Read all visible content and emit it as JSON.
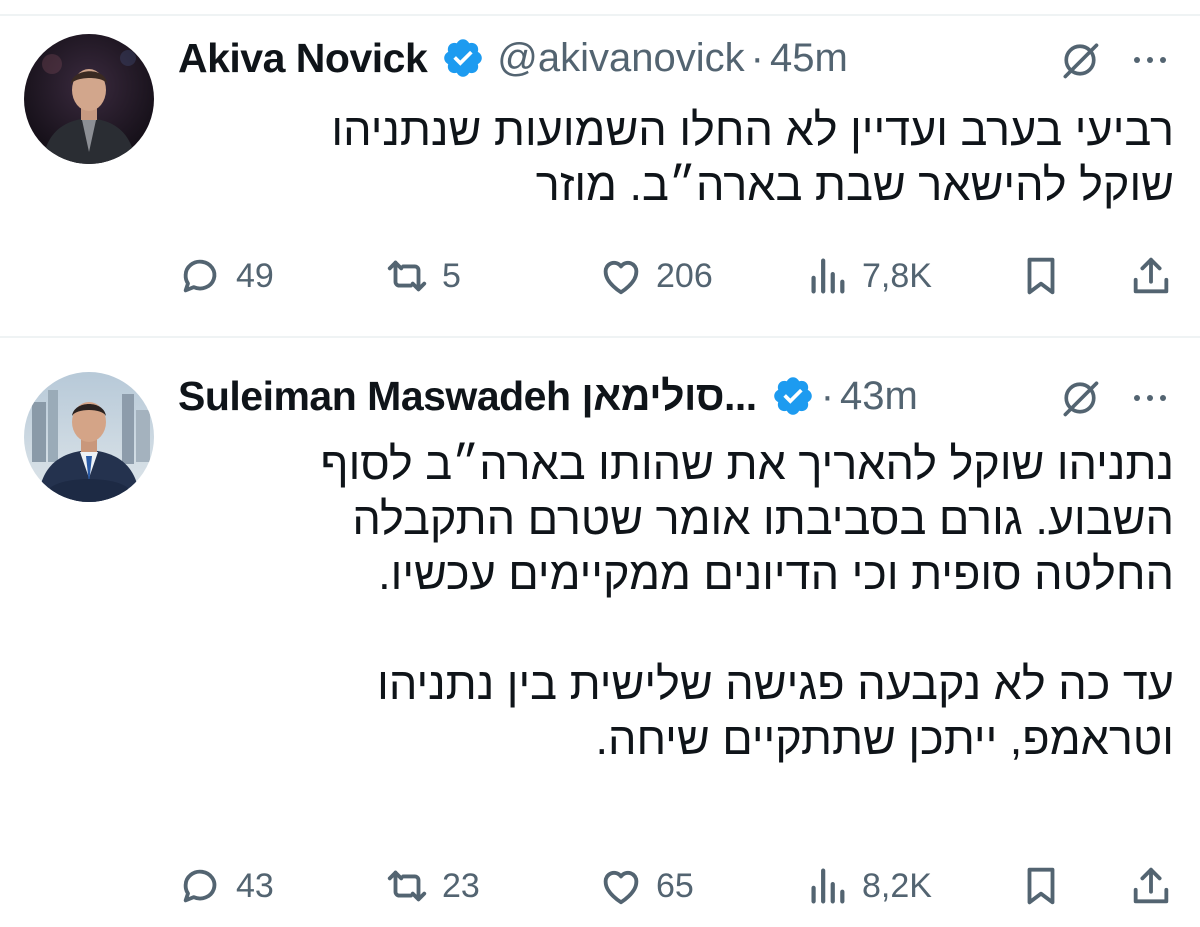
{
  "tweets": [
    {
      "name": "Akiva Novick",
      "handle": "@akivanovick",
      "separator": "·",
      "time": "45m",
      "text": "רביעי בערב ועדיין לא החלו השמועות שנתניהו\nשוקל להישאר שבת בארה״ב. מוזר",
      "stats": {
        "replies": "49",
        "reposts": "5",
        "likes": "206",
        "views": "7,8K"
      }
    },
    {
      "name": "Suleiman Maswadeh סולימאן...",
      "handle": "",
      "separator": "·",
      "time": "43m",
      "text": "נתניהו שוקל להאריך את שהותו בארה״ב לסוף\nהשבוע. גורם בסביבתו אומר שטרם התקבלה\nהחלטה סופית וכי הדיונים ממקיימים עכשיו.\n\nעד כה לא נקבעה פגישה שלישית בין נתניהו\nוטראמפ, ייתכן שתתקיים שיחה.",
      "stats": {
        "replies": "43",
        "reposts": "23",
        "likes": "65",
        "views": "8,2K"
      }
    }
  ],
  "colors": {
    "verified": "#1d9bf0",
    "muted": "#536471",
    "text": "#0f1419",
    "divider": "#eff3f4"
  },
  "icons": [
    "verified-badge-icon",
    "grok-icon",
    "more-icon",
    "reply-icon",
    "repost-icon",
    "like-icon",
    "views-icon",
    "bookmark-icon",
    "share-icon"
  ]
}
